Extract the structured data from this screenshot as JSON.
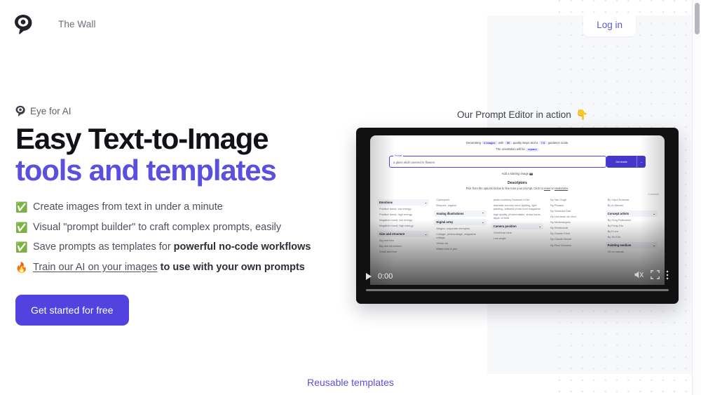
{
  "header": {
    "logo_icon": "eye-logo-icon",
    "brand_name": "The Wall",
    "login_label": "Log in"
  },
  "hero": {
    "eyebrow_icon": "eye-icon",
    "eyebrow": "Eye for AI",
    "headline_line1": "Easy Text-to-Image",
    "headline_line2": "tools and templates",
    "features": [
      {
        "icon": "✅",
        "icon_name": "check-mark-emoji",
        "text_before": "Create images from text in under a minute",
        "link": "",
        "text_after": "",
        "bold": ""
      },
      {
        "icon": "✅",
        "icon_name": "check-mark-emoji",
        "text_before": "Visual \"prompt builder\" to craft complex prompts, easily",
        "link": "",
        "text_after": "",
        "bold": ""
      },
      {
        "icon": "✅",
        "icon_name": "check-mark-emoji",
        "text_before": "Save prompts as templates for ",
        "link": "",
        "text_after": "",
        "bold": "powerful no-code workflows"
      },
      {
        "icon": "🔥",
        "icon_name": "fire-emoji",
        "text_before": "",
        "link": "Train our AI on your images",
        "text_after": " ",
        "bold": "to use with your own prompts"
      }
    ],
    "cta_label": "Get started for free"
  },
  "video_section": {
    "label": "Our Prompt Editor in action",
    "label_icon": "pointing-down-hand-emoji",
    "time": "0:00",
    "play_icon": "play-icon",
    "mute_icon": "muted-speaker-icon",
    "fullscreen_icon": "fullscreen-icon",
    "more_icon": "vertical-dots-icon"
  },
  "app_screenshot": {
    "generating_prefix": "Generating",
    "images_pill": "4 images",
    "generating_mid": "with",
    "steps_pill": "50",
    "generating_mid2": "quality steps and a",
    "guidance_pill": "7.5",
    "generating_suffix": "guidance scale.",
    "orientation_prefix": "The orientation will be",
    "orientation_pill": "square",
    "prompt_label": "Prompt",
    "prompt_value": "a glass skull covered in flowers",
    "generate_label": "Generate",
    "generate_caret": "⌄",
    "add_image": "Add a starting image  📷",
    "descriptors_title": "Descriptors",
    "descriptors_sub_before": "Pick from the options below to fine tune your prompt. Click to ",
    "descriptors_link1": "reset",
    "descriptors_sub_mid": " or ",
    "descriptors_link2": "randomize",
    "descriptors_sub_after": ".",
    "selected_count": "0 selected",
    "columns": [
      {
        "groups": [
          {
            "title": "Emotions",
            "chevron": "⌄",
            "options": [
              "Positive mood, low energy",
              "Positive mood, high energy",
              "Negative mood, low energy",
              "Negative mood, high energy"
            ]
          },
          {
            "title": "Size and structure",
            "chevron": "⌄",
            "options": [
              "Big and free",
              "Big and structured",
              "Small and free"
            ]
          }
        ]
      },
      {
        "groups": [
          {
            "title": "",
            "chevron": "",
            "options": [
              "Cyberpunk",
              "Biopunk, organic"
            ]
          },
          {
            "title": "Analog illustrations",
            "chevron": "⌃",
            "options": []
          },
          {
            "title": "Digital artsy",
            "chevron": "⌄",
            "options": [
              "Alegria, corporate memphis",
              "Collage, photocollage, magazine collage",
              "Vector art",
              "Watercolor & pen"
            ]
          }
        ]
      },
      {
        "groups": [
          {
            "title": "",
            "chevron": "",
            "options": [
              "photo courtesy Museum of Art",
              "dramatic low-key neon lighting, light painting, editorial photo from magazine",
              "high quality, photorealistic, sharp focus, depth of field"
            ]
          },
          {
            "title": "Camera position",
            "chevron": "⌄",
            "options": [
              "Overhead view",
              "Low angle"
            ]
          }
        ]
      },
      {
        "groups": [
          {
            "title": "",
            "chevron": "",
            "options": [
              "By Van Gogh",
              "By Picasso",
              "By Salvador Dali",
              "By Leonardo da Vinci",
              "By Michelangelo",
              "By Rembrandt",
              "By Gustav Klimt",
              "By Claude Monet",
              "By Paul Cézanne"
            ]
          }
        ]
      },
      {
        "groups": [
          {
            "title": "",
            "chevron": "",
            "options": [
              "By Yayoi Kusama",
              "By Ai Weiwei"
            ]
          },
          {
            "title": "Concept artists",
            "chevron": "⌄",
            "options": [
              "By Greg Rutkowski",
              "By Feng Zhu",
              "By Il Lee",
              "By Jin Kim"
            ]
          },
          {
            "title": "Painting medium",
            "chevron": "⌄",
            "options": [
              "Oil on canvas"
            ]
          }
        ]
      }
    ]
  },
  "footer": {
    "reusable_templates": "Reusable templates"
  },
  "colors": {
    "brand_purple": "#5243e0",
    "headline_purple": "#5b4fe0",
    "text_dark": "#111218",
    "text_muted": "#4d515d",
    "panel_bg": "#f7f8fa"
  }
}
